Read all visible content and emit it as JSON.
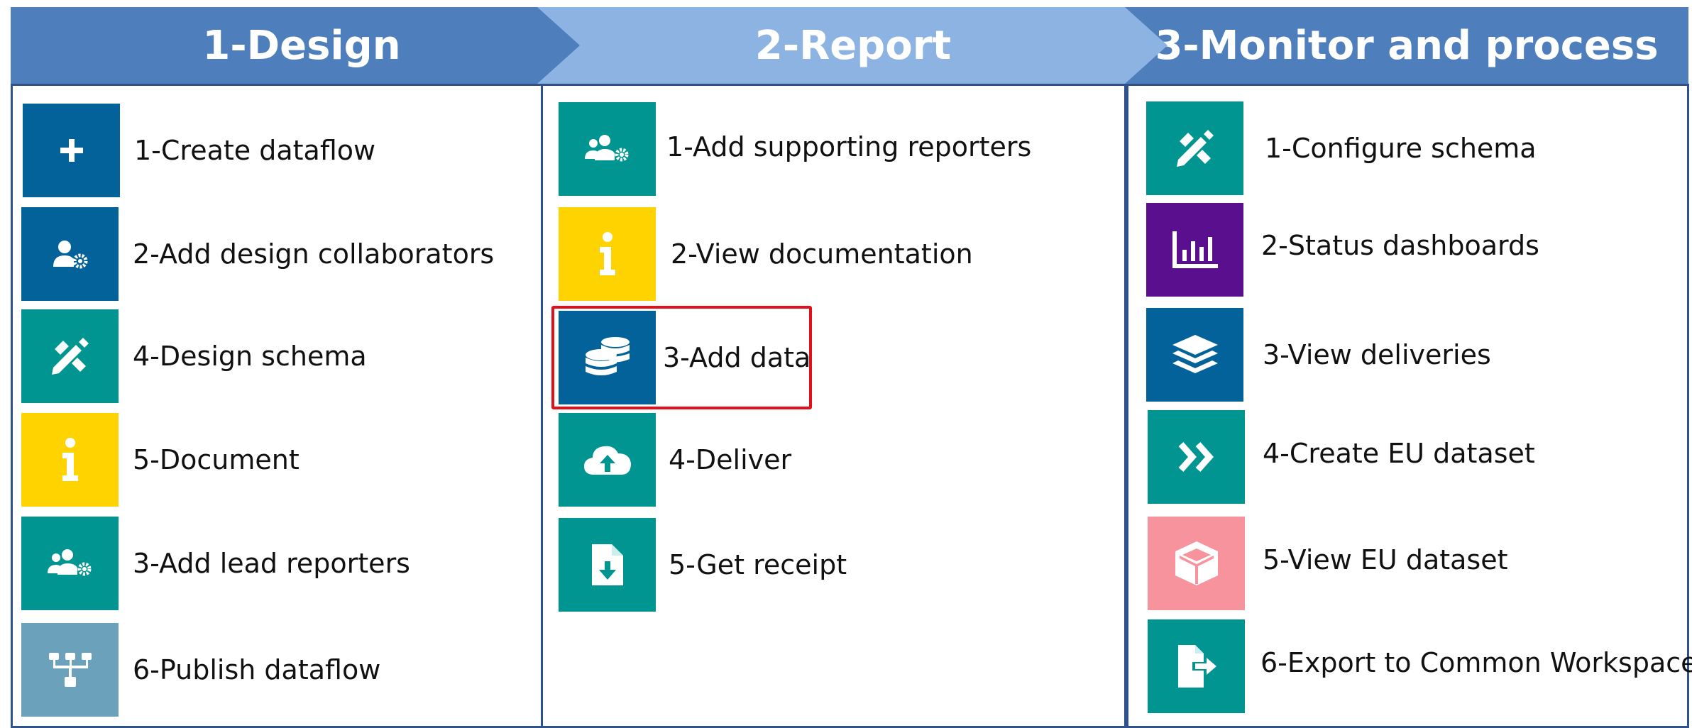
{
  "headers": {
    "design": "1-Design",
    "report": "2-Report",
    "monitor": "3-Monitor and process"
  },
  "colors": {
    "header_dark": "#4e7fbc",
    "header_light": "#8db3e2",
    "tile_blue": "#04629b",
    "tile_teal": "#009591",
    "tile_yellow": "#ffd300",
    "tile_gray_blue": "#6ca1bc",
    "tile_purple": "#5a0f8f",
    "tile_pink": "#f6939c",
    "highlight": "#e2101a"
  },
  "design": {
    "items": [
      {
        "label": "1-Create dataflow",
        "icon": "plus-icon"
      },
      {
        "label": "2-Add design collaborators",
        "icon": "user-gear-icon"
      },
      {
        "label": "4-Design schema",
        "icon": "pencil-ruler-icon"
      },
      {
        "label": "5-Document",
        "icon": "info-icon"
      },
      {
        "label": "3-Add lead reporters",
        "icon": "users-gear-icon"
      },
      {
        "label": "6-Publish dataflow",
        "icon": "sitemap-icon"
      }
    ]
  },
  "report": {
    "items": [
      {
        "label": "1-Add supporting reporters",
        "icon": "users-gear-icon"
      },
      {
        "label": "2-View documentation",
        "icon": "info-icon"
      },
      {
        "label": "3-Add data",
        "icon": "coins-icon"
      },
      {
        "label": "4-Deliver",
        "icon": "cloud-upload-icon"
      },
      {
        "label": "5-Get receipt",
        "icon": "file-download-icon"
      }
    ]
  },
  "monitor": {
    "items": [
      {
        "label": "1-Configure schema",
        "icon": "pencil-ruler-icon"
      },
      {
        "label": "2-Status dashboards",
        "icon": "bar-chart-icon"
      },
      {
        "label": "3-View deliveries",
        "icon": "layers-icon"
      },
      {
        "label": "4-Create EU dataset",
        "icon": "double-chevron-right-icon"
      },
      {
        "label": "5-View EU dataset",
        "icon": "cube-icon"
      },
      {
        "label": "6-Export to Common Workspace",
        "icon": "file-export-icon"
      }
    ]
  }
}
